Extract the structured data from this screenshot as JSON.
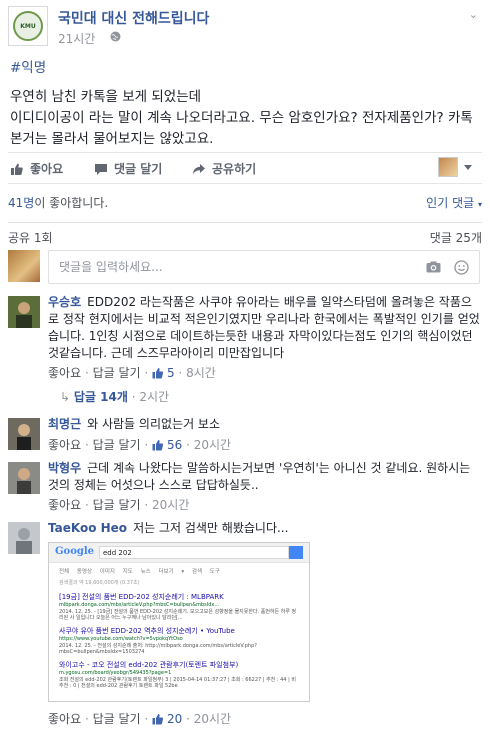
{
  "post": {
    "page_name": "국민대 대신 전해드립니다",
    "page_logo_text": "KMU",
    "time": "21시간",
    "hashtag": "#익명",
    "body_lines": [
      "우연히 남친 카톡을 보게 되었는데",
      "이디디이공이 라는 말이 계속 나오더라고요. 무슨 암호인가요? 전자제품인가? 카톡 본거는 몰라서 물어보지는 않았고요."
    ]
  },
  "actions": {
    "like": "좋아요",
    "comment": "댓글 달기",
    "share": "공유하기"
  },
  "summary": {
    "likes_number": "41명",
    "likes_suffix": "이 좋아합니다.",
    "sort_label": "인기 댓글",
    "shares": "공유 1회",
    "comments": "댓글 25개"
  },
  "composer": {
    "placeholder": "댓글을 입력하세요..."
  },
  "comments": [
    {
      "author": "우승호",
      "text": "EDD202 라는작품은 사쿠야 유아라는 배우를 일약스타덤에 올려놓은 작품으로 정작 현지에서는 비교적 적은인기였지만 우리나라 한국에서는 폭발적인 인기를 얻었습니다. 1인칭 시점으로 데이트하는듯한 내용과 자막이있다는점도 인기의 핵심이었던것같습니다. 근데 스즈무라아이리 미만잡입니다",
      "like": "좋아요",
      "reply": "답글 달기",
      "likes": "5",
      "time": "8시간",
      "replies_label": "답글 14개",
      "replies_time": "2시간"
    },
    {
      "author": "최명근",
      "text": "와 사람들 의리없는거 보소",
      "like": "좋아요",
      "reply": "답글 달기",
      "likes": "56",
      "time": "20시간"
    },
    {
      "author": "박형우",
      "text": "근데 계속 나왔다는 말씀하시는거보면 '우연히'는 아니신 것 같네요. 원하시는 것의 정체는 어섯으나 스스로 답답하실듯..",
      "like": "좋아요",
      "reply": "답글 달기",
      "time": "20시간"
    },
    {
      "author": "TaeKoo Heo",
      "text": "저는 그저 검색만 해봤습니다...",
      "like": "좋아요",
      "reply": "답글 달기",
      "likes": "20",
      "time": "20시간"
    }
  ],
  "screenshot": {
    "logo": "Google",
    "query": "edd 202",
    "tabs": "전체  동영상  이미지  지도  뉴스  더보기 ▾  검색 도구",
    "stats": "검색결과 약 19,600,000개 (0.37초)",
    "results": [
      {
        "title": "[19금] 전설의 품번 EDD-202 성지순례기 : MLBPARK",
        "url": "mlbpark.donga.com/mbs/articleV.php?mbsC=bullpen&mbsIdx...",
        "snippet": "2014. 12. 25. - [19금] 전설의 품번 EDD-202 성지순례기. 모으고모은 성향정을 몰지못한다. 품번하든 하루 정리된 사 일입니다 오늘은 어느 누구께나 남아있니 달리던[..."
      },
      {
        "title": "사쿠야 유아 품번 EDD-202 역추의 성지순례기 • YouTube",
        "url": "https://www.youtube.com/watch?v=5vpokqYtOso",
        "snippet": "2014. 12. 25. - 전설의 성지순례 출처: http://mlbpark.donga.com/mbs/articleV.php?mbsC=bullpen&mbsIdx=1503274"
      },
      {
        "title": "와이고수 - 코오 전설의 edd-202 관람후기(토렌트 파일첨부)",
        "url": "m.ygosu.com/board/yeobgr/549435?page=1",
        "snippet": "조회 전설의 edd-202 관람후기(토렌트 파일첨부) 3 | 2015-04-14 01:37:27 | 조회 : 66227 | 추천 : 44 | 비추천 : 0 | 전설의 edd-202 관람후기 토렌트 파일 52be"
      }
    ]
  },
  "colors": {
    "link": "#365899",
    "meta": "#90949c",
    "divider": "#e5e5e5"
  }
}
